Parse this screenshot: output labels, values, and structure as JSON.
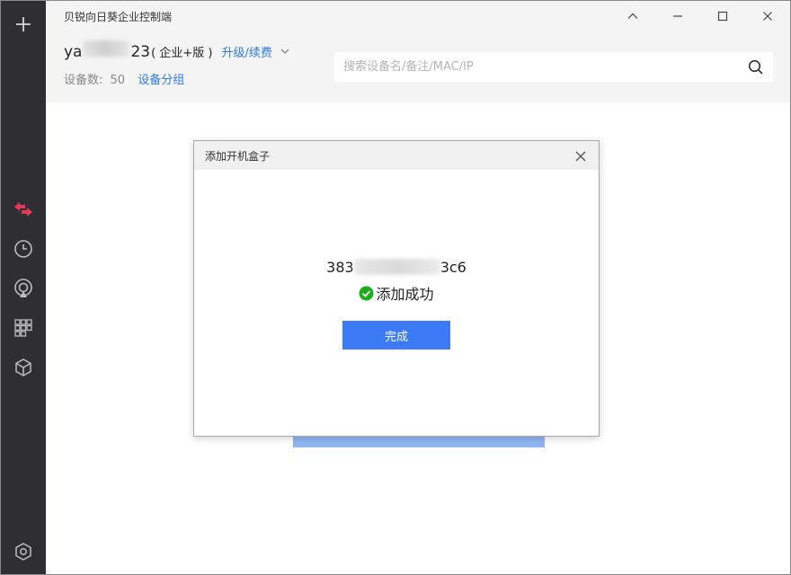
{
  "window": {
    "title": "贝锐向日葵企业控制端"
  },
  "sidebar": {
    "items": [
      {
        "icon": "plus-icon"
      },
      {
        "icon": "remote-control-icon"
      },
      {
        "icon": "history-clock-icon"
      },
      {
        "icon": "broadcast-icon"
      },
      {
        "icon": "apps-grid-icon"
      },
      {
        "icon": "box-cube-icon"
      },
      {
        "icon": "settings-hexagon-icon"
      }
    ]
  },
  "account": {
    "name_prefix": "ya",
    "name_suffix": "23",
    "edition": "( 企业+版 )",
    "upgrade_label": "升级/续费"
  },
  "devices": {
    "count_label": "设备数:",
    "count": "50",
    "group_label": "设备分组"
  },
  "search": {
    "placeholder": "搜索设备名/备注/MAC/IP"
  },
  "dialog": {
    "title": "添加开机盒子",
    "device_id_prefix": "383",
    "device_id_suffix": "3c6",
    "status_text": "添加成功",
    "done_label": "完成"
  },
  "colors": {
    "accent": "#3c7bf5",
    "link": "#2e7bf0",
    "success": "#1aad19",
    "sidebar_bg": "#2f2f33",
    "remote_icon": "#e8385a"
  }
}
